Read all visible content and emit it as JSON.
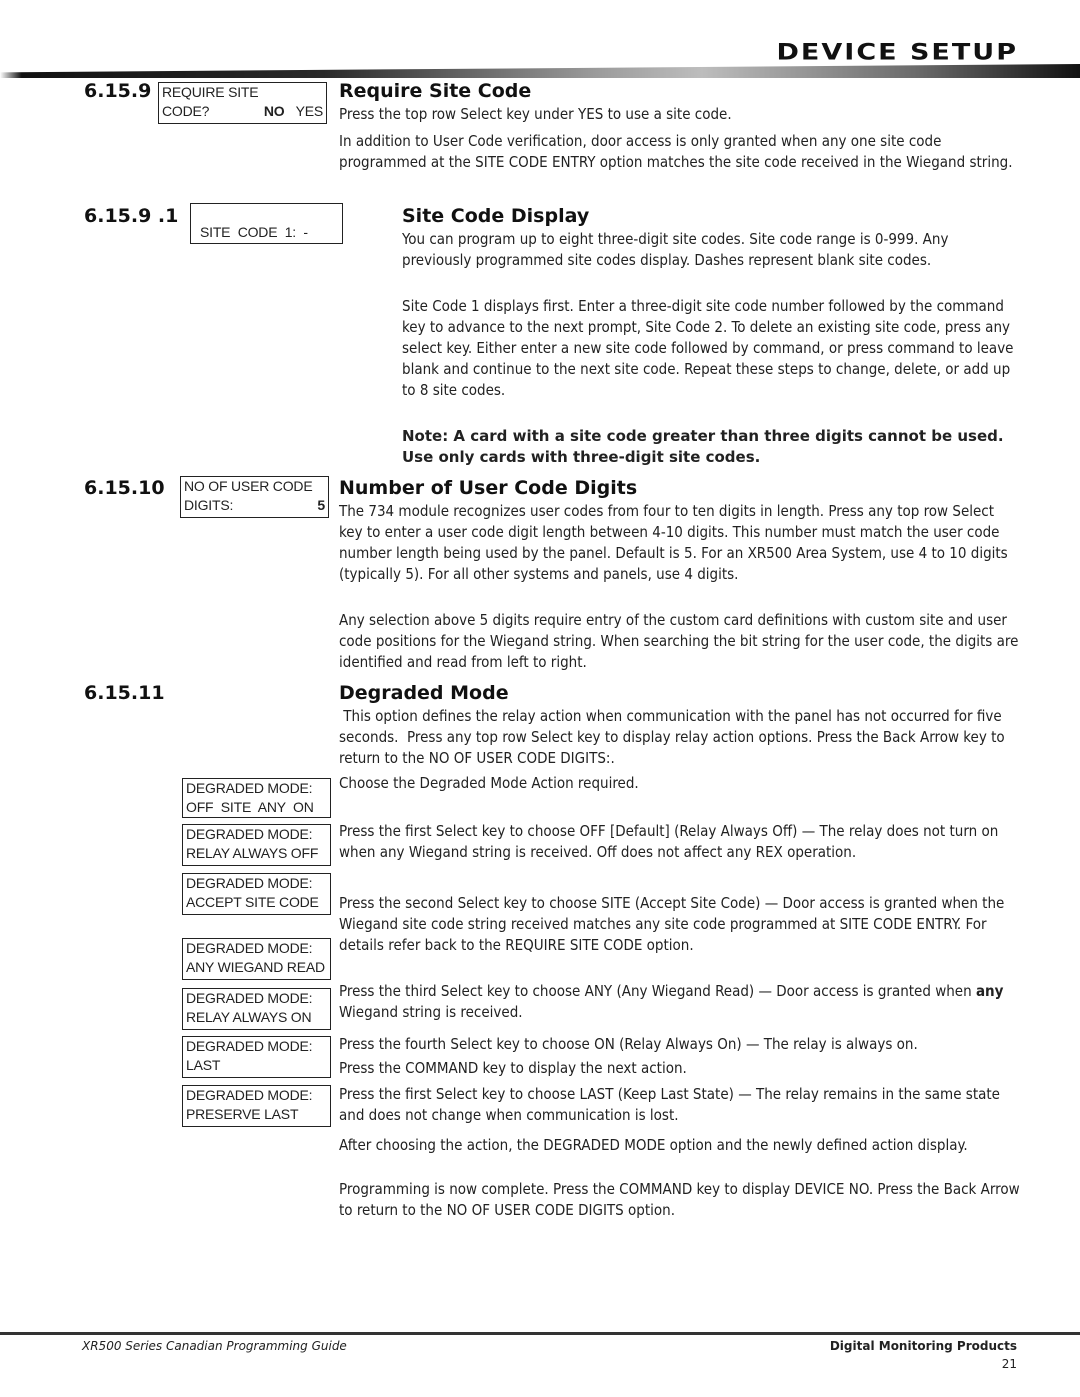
{
  "header": {
    "title": "DEVICE SETUP"
  },
  "sections": {
    "require_site_code": {
      "number": "6.15.9",
      "lcd": {
        "line1": "REQUIRE SITE",
        "line2_label": "CODE?",
        "line2_opt1": "NO",
        "line2_opt2": "YES"
      },
      "title": "Require Site Code",
      "paragraphs": [
        "Press the top row Select key under YES to use a site code.",
        "In addition to User Code verification, door access is only granted when any one site code programmed at the SITE CODE ENTRY option matches the site code received in the Wiegand string."
      ]
    },
    "site_code_display": {
      "number": "6.15.9 .1",
      "lcd": {
        "line1": "",
        "line2": "SITE  CODE  1:  -"
      },
      "title": "Site Code Display",
      "paragraphs": [
        "You can program up to eight three-digit site codes.  Site code range is 0-999. Any previously programmed site codes display.  Dashes represent blank site codes.",
        "Site Code 1 displays first.  Enter a three-digit site code number followed by the command key to advance to the next prompt, Site Code 2.  To delete an existing site code, press any select key.  Either enter a new site code followed by command, or press command to leave blank and continue to the next site code.  Repeat these steps to change, delete, or add up to 8 site codes."
      ],
      "note": "Note: A card with a site code greater than three digits cannot be used. Use only cards with three-digit site codes."
    },
    "user_code_digits": {
      "number": "6.15.10",
      "lcd": {
        "line1": "NO OF USER CODE",
        "line2_label": "DIGITS:",
        "line2_value": "5"
      },
      "title": "Number of User Code Digits",
      "paragraphs": [
        "The 734 module recognizes user codes from four to ten digits in length.  Press any top row Select key to enter a user code digit length between 4-10 digits.  This number must match the user code number length being used by the panel.  Default is 5.  For an XR500 Area System, use 4 to 10 digits (typically 5). For all other systems and panels, use 4 digits.",
        "Any selection above 5 digits require entry of the custom card definitions with custom site and user code positions for the Wiegand string.  When searching the bit string for the user code, the digits are identified and read from left to right."
      ]
    },
    "degraded_mode": {
      "number": "6.15.11",
      "title": "Degraded Mode",
      "intro": " This option defines the relay action when communication with the panel has not occurred for five seconds.  Press any top row Select key to display relay action options. Press the Back Arrow key to return to the NO OF USER CODE DIGITS:.",
      "lcds": [
        {
          "line1": "DEGRADED MODE:",
          "line2": "OFF  SITE  ANY  ON"
        },
        {
          "line1": "DEGRADED MODE:",
          "line2": "RELAY ALWAYS OFF"
        },
        {
          "line1": "DEGRADED MODE:",
          "line2": "ACCEPT SITE CODE"
        },
        {
          "line1": "DEGRADED MODE:",
          "line2": "ANY WIEGAND READ"
        },
        {
          "line1": "DEGRADED MODE:",
          "line2": "RELAY ALWAYS ON"
        },
        {
          "line1": "DEGRADED MODE:",
          "line2": "LAST"
        },
        {
          "line1": "DEGRADED MODE:",
          "line2": "PRESERVE LAST"
        }
      ],
      "paragraphs": {
        "choose": "Choose the Degraded Mode Action required.",
        "off": "Press the first Select key to choose OFF [Default] (Relay Always Off) — The relay does not turn on when any Wiegand string is received.  Off does not affect any REX operation.",
        "site": "Press the second Select key to choose SITE (Accept Site Code) — Door access is granted when the Wiegand site code string received matches any site code programmed at SITE CODE ENTRY.  For details refer back to the REQUIRE SITE CODE option.",
        "any_pre": "Press the third Select key to choose ANY (Any Wiegand Read) — Door access is granted when ",
        "any_bold": "any",
        "any_post": " Wiegand string is received.",
        "on": "Press the fourth Select key to choose ON (Relay Always On) — The relay is always on.",
        "command": "Press the COMMAND key to display the next action.",
        "last": "Press the first Select key to choose LAST (Keep Last State) — The relay remains in the same state and does not change when communication is lost.",
        "after": "After choosing the action, the DEGRADED MODE option and the newly defined action display.",
        "complete": "Programming is now complete.  Press the COMMAND key to display DEVICE NO.  Press the Back Arrow to return to the NO OF USER CODE DIGITS option."
      }
    }
  },
  "footer": {
    "guide": "XR500 Series Canadian Programming Guide",
    "company": "Digital Monitoring Products",
    "page": "21"
  }
}
